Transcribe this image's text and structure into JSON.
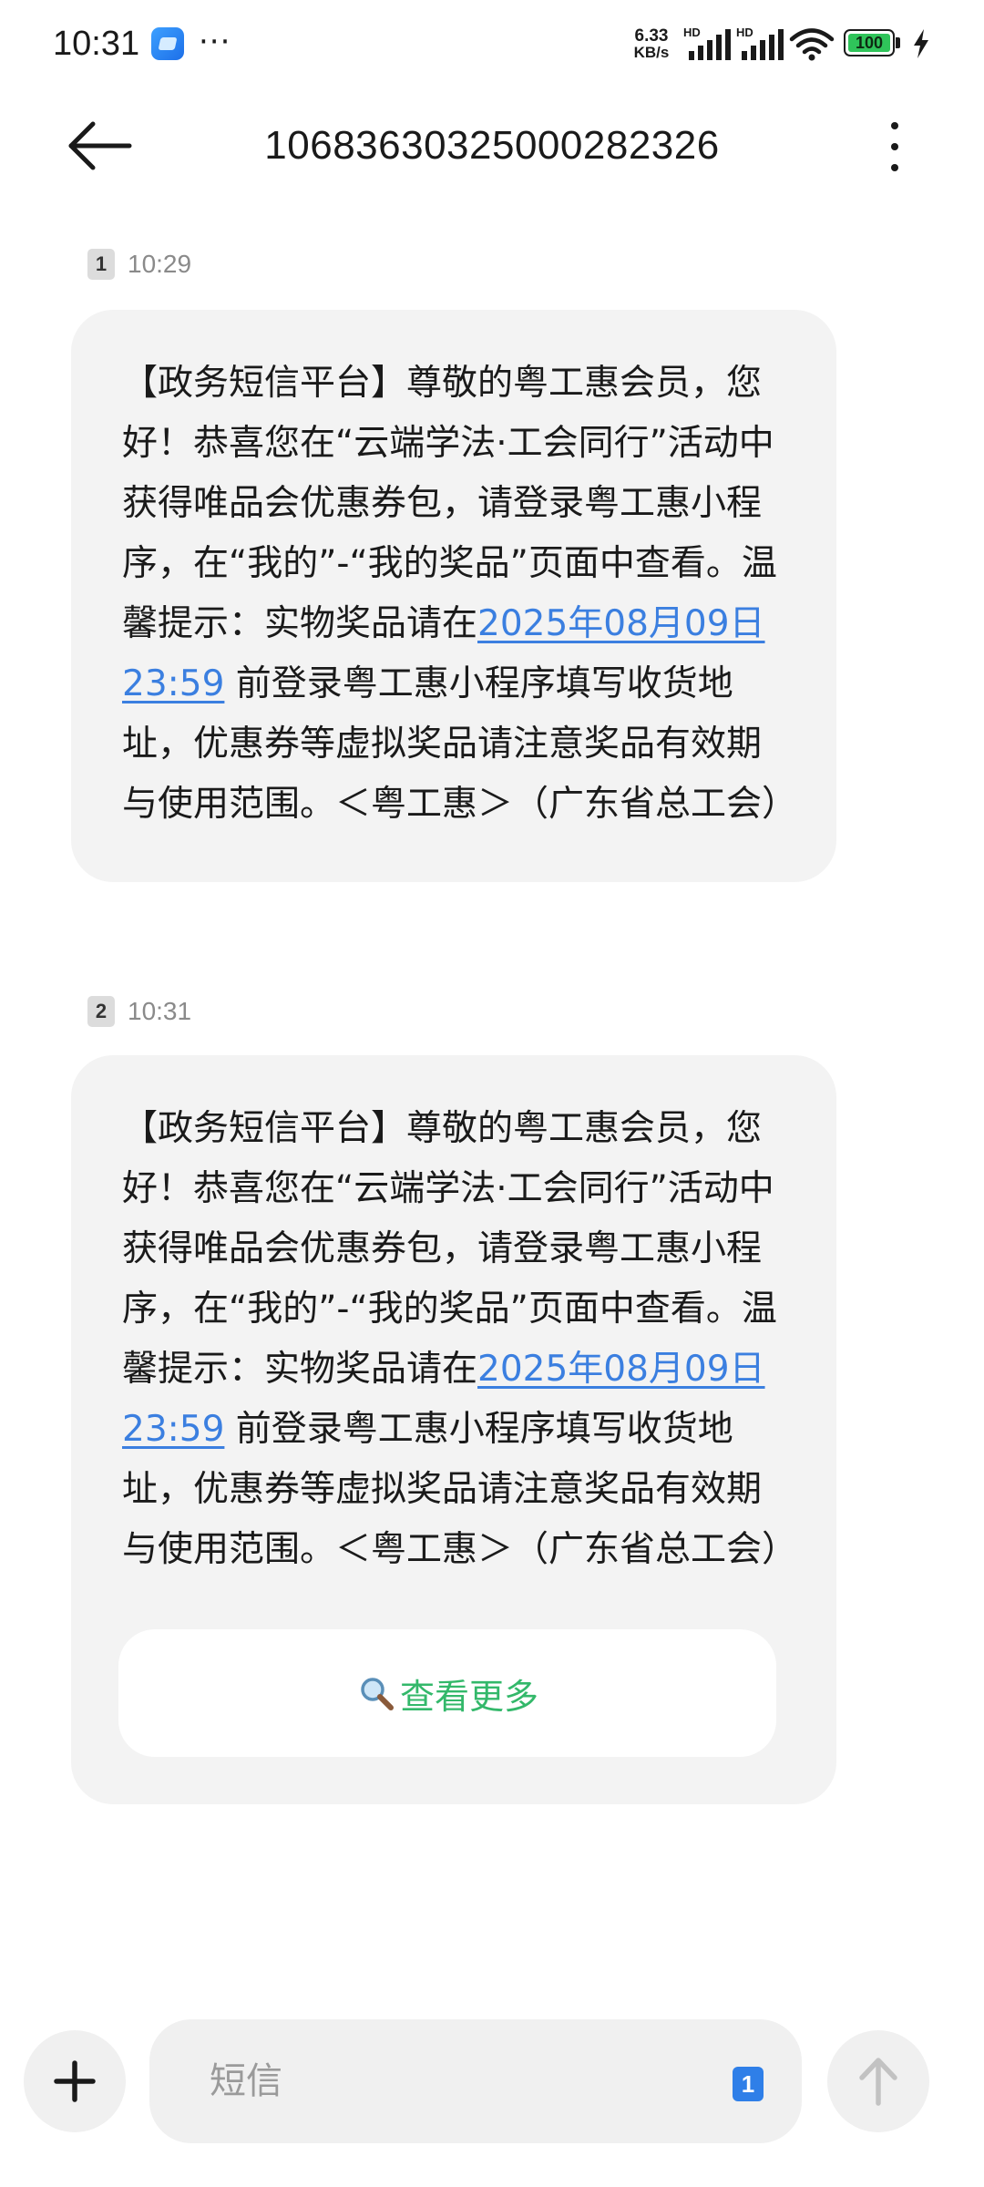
{
  "status_bar": {
    "time": "10:31",
    "more": "···",
    "net_speed_value": "6.33",
    "net_speed_unit": "KB/s",
    "signal_tag": "HD",
    "battery": "100"
  },
  "header": {
    "title": "1068363032500028​2326",
    "back_icon": "arrow-left-icon",
    "menu_icon": "more-vertical-icon"
  },
  "messages": [
    {
      "sim": "1",
      "time": "10:29",
      "text_before": "【政务短信平台】尊敬的粤工惠会员，您好！恭喜您在“云端学法·工会同行”活动中获得唯品会优惠券包，请登录粤工惠小程序，在“我的”-“我的奖品”页面中查看。温馨提示：实物奖品请在",
      "link": "2025年08月09日23:59",
      "text_after": " 前登录粤工惠小程序填写收货地址，优惠券等虚拟奖品请注意奖品有效期与使用范围。＜粤工惠＞（广东省总工会）"
    },
    {
      "sim": "2",
      "time": "10:31",
      "text_before": "【政务短信平台】尊敬的粤工惠会员，您好！恭喜您在“云端学法·工会同行”活动中获得唯品会优惠券包，请登录粤工惠小程序，在“我的”-“我的奖品”页面中查看。温馨提示：实物奖品请在",
      "link": "2025年08月09日23:59",
      "text_after": " 前登录粤工惠小程序填写收货地址，优惠券等虚拟奖品请注意奖品有效期与使用范围。＜粤工惠＞（广东省总工会）",
      "action_label": "查看更多"
    }
  ],
  "compose": {
    "placeholder": "短信",
    "sim": "1"
  },
  "colors": {
    "link": "#3b7fe0",
    "action": "#33b86a",
    "bubble": "#f3f3f3",
    "sim_active": "#2f7fe8",
    "battery": "#2fc45a"
  }
}
